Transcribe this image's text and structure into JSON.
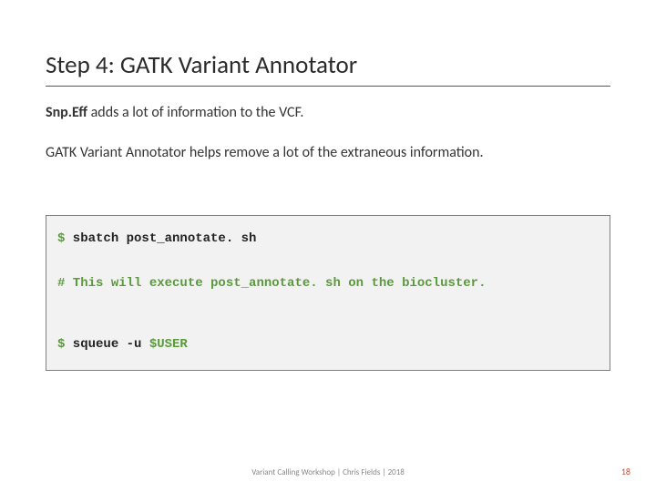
{
  "title": "Step 4: GATK Variant Annotator",
  "para1": {
    "bold": "Snp.Eff",
    "rest": " adds a lot of information to the VCF."
  },
  "para2": "GATK Variant Annotator helps remove a lot of the extraneous information.",
  "code": {
    "prompt1": "$",
    "cmd1": " sbatch post_annotate. sh",
    "comment_hash": "#",
    "comment_rest": " This will execute post_annotate. sh on the biocluster.",
    "prompt2": "$",
    "cmd2_a": " squeue -u ",
    "cmd2_var": "$USER"
  },
  "footer": {
    "center": "Variant Calling Workshop | Chris Fields | 2018",
    "page": "18"
  }
}
